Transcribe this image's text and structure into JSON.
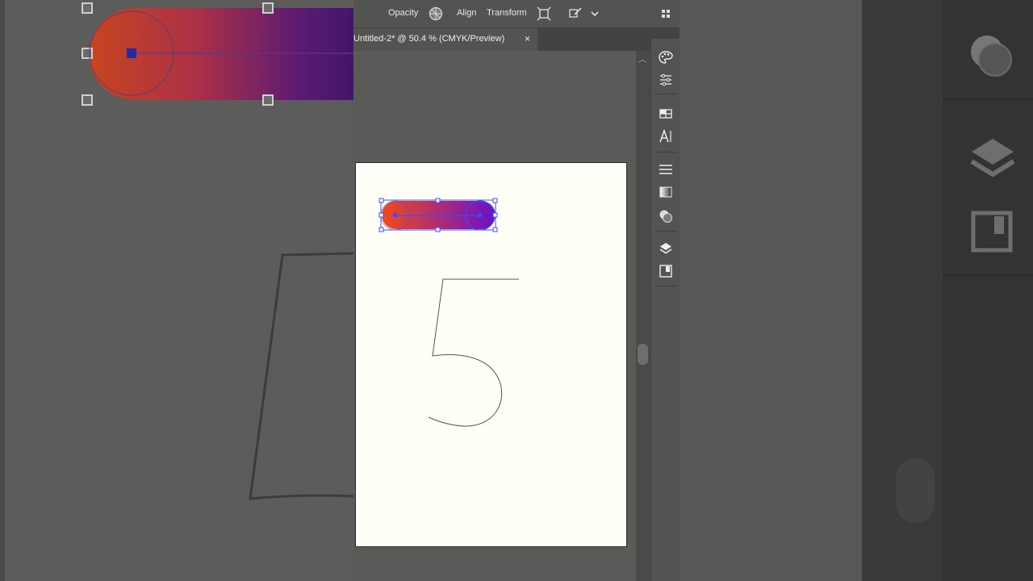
{
  "toolbar": {
    "opacity_label": "Opacity",
    "align_label": "Align",
    "transform_label": "Transform"
  },
  "document_tab": {
    "title": "Untitled-2* @ 50.4 % (CMYK/Preview)",
    "close_glyph": "×"
  },
  "scrollbar": {
    "up_glyph": "︿"
  },
  "panel_icons": [
    "color-palette-icon",
    "properties-sliders-icon",
    "swatches-icon",
    "character-icon",
    "stroke-icon",
    "gradient-icon",
    "transparency-icon",
    "layers-icon",
    "libraries-icon"
  ],
  "artwork": {
    "gradient_start": "#f24a1c",
    "gradient_end": "#6a10c8",
    "selection_color": "#3a4cff",
    "glyph": "5"
  }
}
